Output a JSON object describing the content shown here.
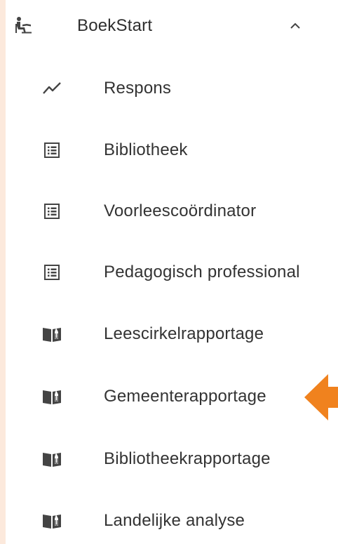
{
  "menu": {
    "header": {
      "label": "BoekStart",
      "icon": "reading-child-icon",
      "expanded": true
    },
    "items": [
      {
        "label": "Respons",
        "icon": "trend-line-icon"
      },
      {
        "label": "Bibliotheek",
        "icon": "list-document-icon"
      },
      {
        "label": "Voorleescoördinator",
        "icon": "list-document-icon"
      },
      {
        "label": "Pedagogisch professional",
        "icon": "list-document-icon"
      },
      {
        "label": "Leescirkelrapportage",
        "icon": "open-book-icon"
      },
      {
        "label": "Gemeenterapportage",
        "icon": "open-book-icon"
      },
      {
        "label": "Bibliotheekrapportage",
        "icon": "open-book-icon"
      },
      {
        "label": "Landelijke analyse",
        "icon": "open-book-icon"
      }
    ]
  },
  "colors": {
    "background": "#fce9dc",
    "panel": "#ffffff",
    "text": "#333333",
    "icon": "#444444",
    "highlight_arrow": "#f0821e"
  }
}
